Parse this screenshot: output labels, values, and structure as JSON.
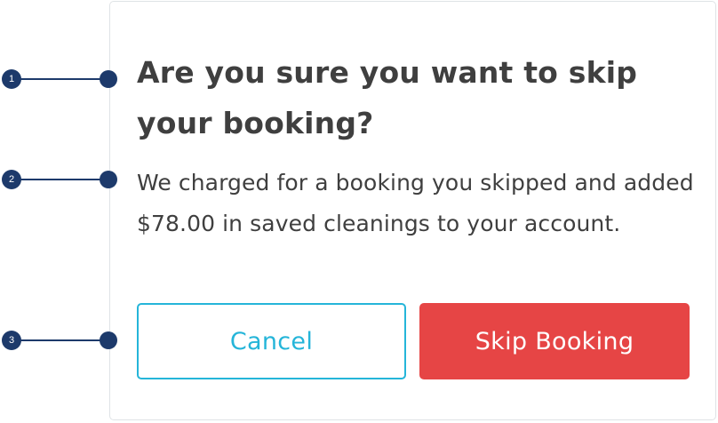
{
  "dialog": {
    "title": "Are you sure you want to skip your booking?",
    "message": "We charged for a booking you skipped and added $78.00 in saved cleanings to your account.",
    "cancel_label": "Cancel",
    "skip_label": "Skip Booking"
  },
  "annotations": [
    {
      "number": "1"
    },
    {
      "number": "2"
    },
    {
      "number": "3"
    }
  ],
  "colors": {
    "title_text": "#3f3f3f",
    "cancel_accent": "#25b5d9",
    "skip_background": "#e64545",
    "annotation_marker": "#1d3a6b",
    "card_border": "#dfe3e6"
  }
}
